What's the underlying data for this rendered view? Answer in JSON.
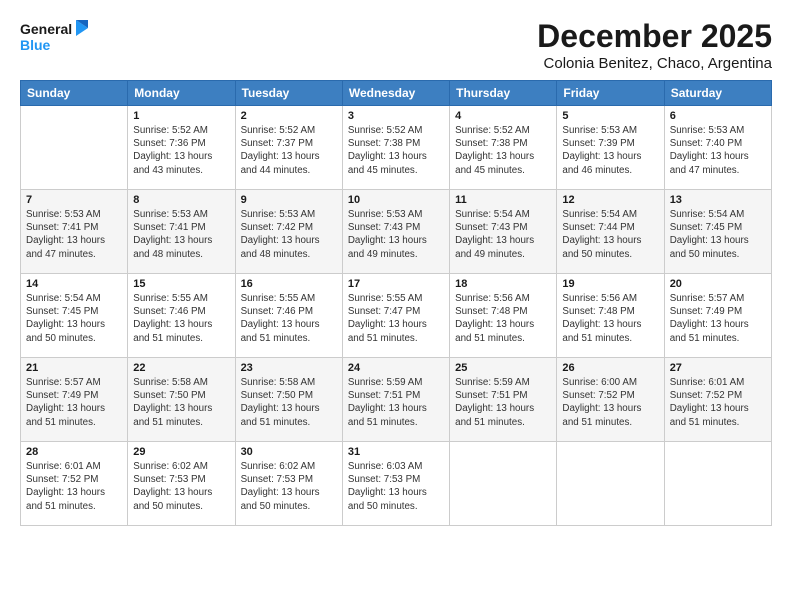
{
  "logo": {
    "line1": "General",
    "line2": "Blue"
  },
  "title": "December 2025",
  "subtitle": "Colonia Benitez, Chaco, Argentina",
  "calendar": {
    "headers": [
      "Sunday",
      "Monday",
      "Tuesday",
      "Wednesday",
      "Thursday",
      "Friday",
      "Saturday"
    ],
    "weeks": [
      [
        {
          "day": "",
          "sunrise": "",
          "sunset": "",
          "daylight": ""
        },
        {
          "day": "1",
          "sunrise": "5:52 AM",
          "sunset": "7:36 PM",
          "daylight": "13 hours and 43 minutes."
        },
        {
          "day": "2",
          "sunrise": "5:52 AM",
          "sunset": "7:37 PM",
          "daylight": "13 hours and 44 minutes."
        },
        {
          "day": "3",
          "sunrise": "5:52 AM",
          "sunset": "7:38 PM",
          "daylight": "13 hours and 45 minutes."
        },
        {
          "day": "4",
          "sunrise": "5:52 AM",
          "sunset": "7:38 PM",
          "daylight": "13 hours and 45 minutes."
        },
        {
          "day": "5",
          "sunrise": "5:53 AM",
          "sunset": "7:39 PM",
          "daylight": "13 hours and 46 minutes."
        },
        {
          "day": "6",
          "sunrise": "5:53 AM",
          "sunset": "7:40 PM",
          "daylight": "13 hours and 47 minutes."
        }
      ],
      [
        {
          "day": "7",
          "sunrise": "5:53 AM",
          "sunset": "7:41 PM",
          "daylight": "13 hours and 47 minutes."
        },
        {
          "day": "8",
          "sunrise": "5:53 AM",
          "sunset": "7:41 PM",
          "daylight": "13 hours and 48 minutes."
        },
        {
          "day": "9",
          "sunrise": "5:53 AM",
          "sunset": "7:42 PM",
          "daylight": "13 hours and 48 minutes."
        },
        {
          "day": "10",
          "sunrise": "5:53 AM",
          "sunset": "7:43 PM",
          "daylight": "13 hours and 49 minutes."
        },
        {
          "day": "11",
          "sunrise": "5:54 AM",
          "sunset": "7:43 PM",
          "daylight": "13 hours and 49 minutes."
        },
        {
          "day": "12",
          "sunrise": "5:54 AM",
          "sunset": "7:44 PM",
          "daylight": "13 hours and 50 minutes."
        },
        {
          "day": "13",
          "sunrise": "5:54 AM",
          "sunset": "7:45 PM",
          "daylight": "13 hours and 50 minutes."
        }
      ],
      [
        {
          "day": "14",
          "sunrise": "5:54 AM",
          "sunset": "7:45 PM",
          "daylight": "13 hours and 50 minutes."
        },
        {
          "day": "15",
          "sunrise": "5:55 AM",
          "sunset": "7:46 PM",
          "daylight": "13 hours and 51 minutes."
        },
        {
          "day": "16",
          "sunrise": "5:55 AM",
          "sunset": "7:46 PM",
          "daylight": "13 hours and 51 minutes."
        },
        {
          "day": "17",
          "sunrise": "5:55 AM",
          "sunset": "7:47 PM",
          "daylight": "13 hours and 51 minutes."
        },
        {
          "day": "18",
          "sunrise": "5:56 AM",
          "sunset": "7:48 PM",
          "daylight": "13 hours and 51 minutes."
        },
        {
          "day": "19",
          "sunrise": "5:56 AM",
          "sunset": "7:48 PM",
          "daylight": "13 hours and 51 minutes."
        },
        {
          "day": "20",
          "sunrise": "5:57 AM",
          "sunset": "7:49 PM",
          "daylight": "13 hours and 51 minutes."
        }
      ],
      [
        {
          "day": "21",
          "sunrise": "5:57 AM",
          "sunset": "7:49 PM",
          "daylight": "13 hours and 51 minutes."
        },
        {
          "day": "22",
          "sunrise": "5:58 AM",
          "sunset": "7:50 PM",
          "daylight": "13 hours and 51 minutes."
        },
        {
          "day": "23",
          "sunrise": "5:58 AM",
          "sunset": "7:50 PM",
          "daylight": "13 hours and 51 minutes."
        },
        {
          "day": "24",
          "sunrise": "5:59 AM",
          "sunset": "7:51 PM",
          "daylight": "13 hours and 51 minutes."
        },
        {
          "day": "25",
          "sunrise": "5:59 AM",
          "sunset": "7:51 PM",
          "daylight": "13 hours and 51 minutes."
        },
        {
          "day": "26",
          "sunrise": "6:00 AM",
          "sunset": "7:52 PM",
          "daylight": "13 hours and 51 minutes."
        },
        {
          "day": "27",
          "sunrise": "6:01 AM",
          "sunset": "7:52 PM",
          "daylight": "13 hours and 51 minutes."
        }
      ],
      [
        {
          "day": "28",
          "sunrise": "6:01 AM",
          "sunset": "7:52 PM",
          "daylight": "13 hours and 51 minutes."
        },
        {
          "day": "29",
          "sunrise": "6:02 AM",
          "sunset": "7:53 PM",
          "daylight": "13 hours and 50 minutes."
        },
        {
          "day": "30",
          "sunrise": "6:02 AM",
          "sunset": "7:53 PM",
          "daylight": "13 hours and 50 minutes."
        },
        {
          "day": "31",
          "sunrise": "6:03 AM",
          "sunset": "7:53 PM",
          "daylight": "13 hours and 50 minutes."
        },
        {
          "day": "",
          "sunrise": "",
          "sunset": "",
          "daylight": ""
        },
        {
          "day": "",
          "sunrise": "",
          "sunset": "",
          "daylight": ""
        },
        {
          "day": "",
          "sunrise": "",
          "sunset": "",
          "daylight": ""
        }
      ]
    ]
  }
}
